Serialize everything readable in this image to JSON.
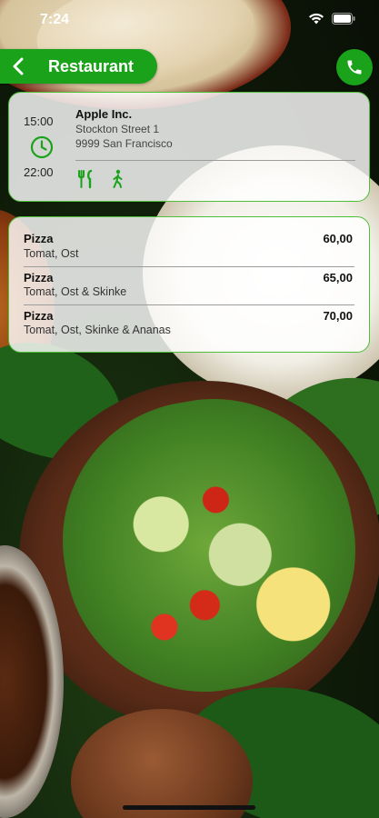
{
  "status_bar": {
    "time": "7:24"
  },
  "nav": {
    "title": "Restaurant",
    "back_icon": "chevron-left-icon",
    "call_icon": "phone-icon"
  },
  "restaurant": {
    "open_time": "15:00",
    "close_time": "22:00",
    "name": "Apple Inc.",
    "street": "Stockton Street 1",
    "city": "9999 San Francisco",
    "features": [
      "fork-knife-icon",
      "walking-person-icon"
    ]
  },
  "menu": [
    {
      "name": "Pizza",
      "description": "Tomat, Ost",
      "price": "60,00"
    },
    {
      "name": "Pizza",
      "description": "Tomat, Ost & Skinke",
      "price": "65,00"
    },
    {
      "name": "Pizza",
      "description": "Tomat, Ost, Skinke & Ananas",
      "price": "70,00"
    }
  ],
  "colors": {
    "accent": "#1aa31a",
    "card_border": "#4fbf3a"
  }
}
